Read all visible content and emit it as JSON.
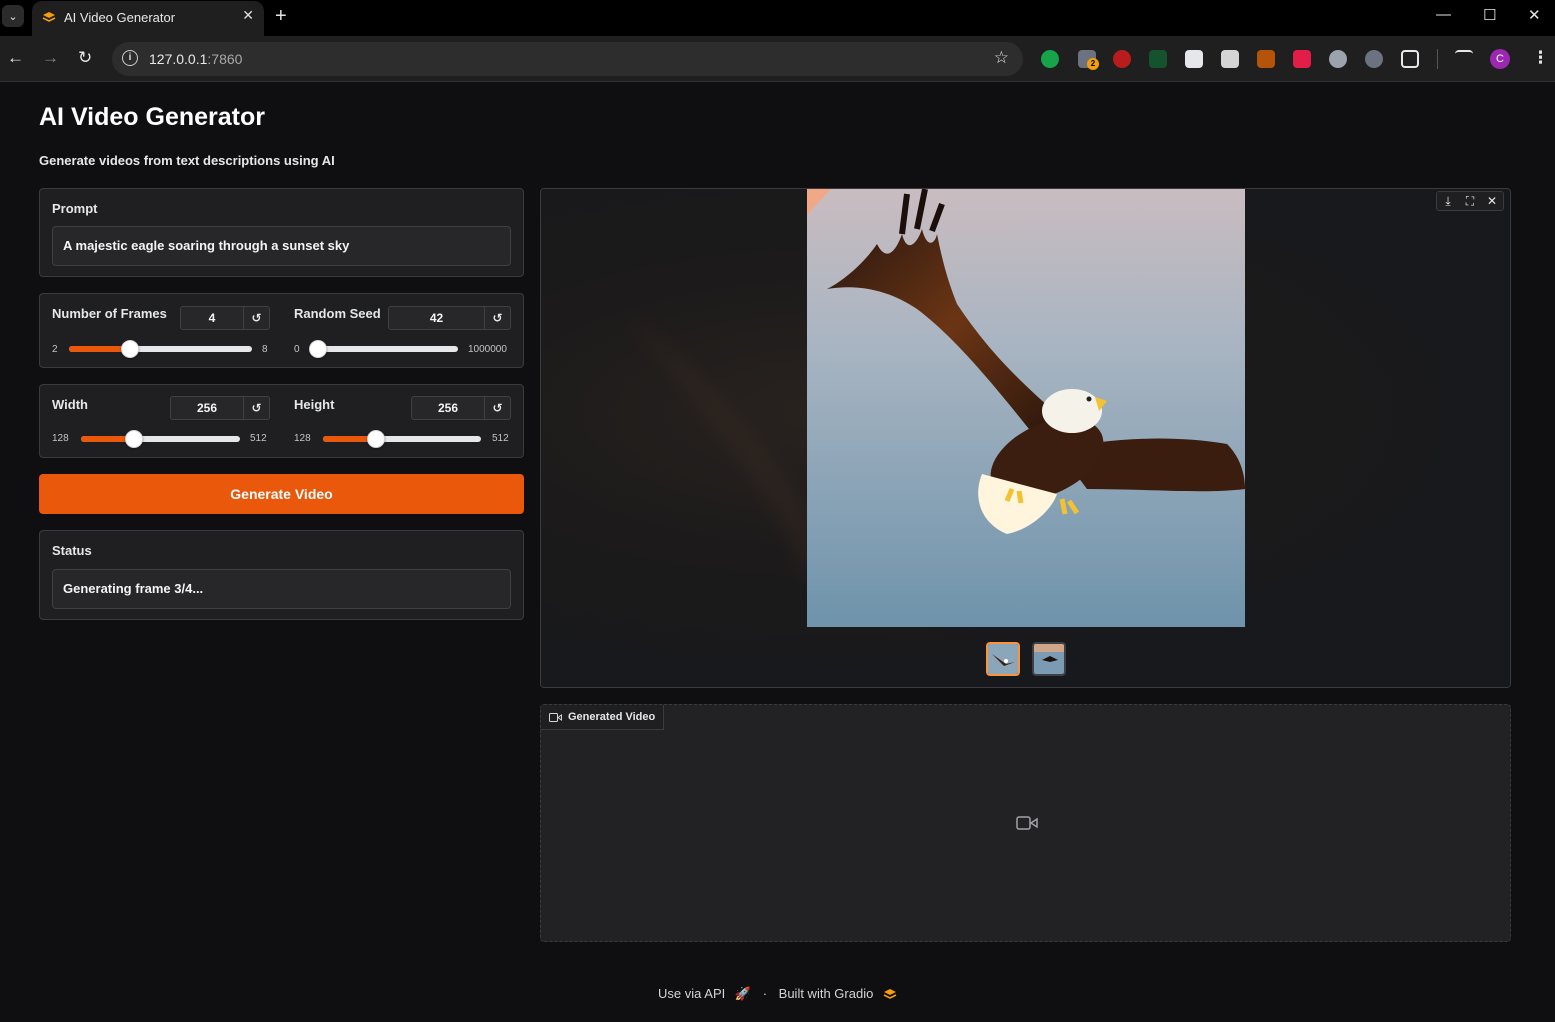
{
  "browser": {
    "tab_title": "AI Video Generator",
    "url_host": "127.0.0.1",
    "url_port": ":7860",
    "profile_initial": "C",
    "extension_badge": "2"
  },
  "app": {
    "title": "AI Video Generator",
    "subtitle": "Generate videos from text descriptions using AI",
    "accent_color": "#ea580c"
  },
  "prompt": {
    "label": "Prompt",
    "value": "A majestic eagle soaring through a sunset sky"
  },
  "frames": {
    "label": "Number of Frames",
    "value": "4",
    "min": "2",
    "max": "8",
    "fraction": 0.333
  },
  "seed": {
    "label": "Random Seed",
    "value": "42",
    "min": "0",
    "max": "1000000",
    "fraction": 4e-05
  },
  "width": {
    "label": "Width",
    "value": "256",
    "min": "128",
    "max": "512",
    "fraction": 0.333
  },
  "height": {
    "label": "Height",
    "value": "256",
    "min": "128",
    "max": "512",
    "fraction": 0.333
  },
  "generate_button": "Generate Video",
  "status": {
    "label": "Status",
    "value": "Generating frame 3/4..."
  },
  "gallery": {
    "image_subject": "bald eagle in flight over pale sky",
    "thumbnail_count": 2,
    "selected_index": 0
  },
  "video": {
    "label": "Generated Video"
  },
  "footer": {
    "api_link": "Use via API",
    "separator": "·",
    "built_with": "Built with Gradio"
  }
}
